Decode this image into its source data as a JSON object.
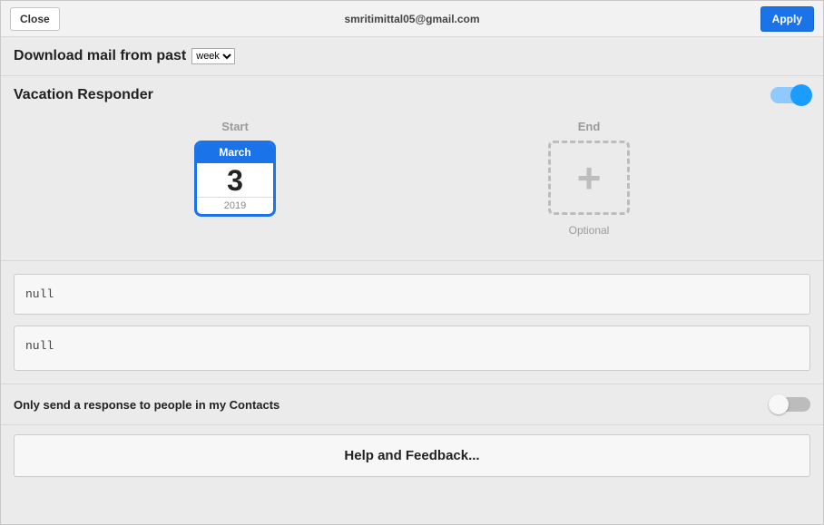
{
  "topbar": {
    "close_label": "Close",
    "email": "smritimittal05@gmail.com",
    "apply_label": "Apply"
  },
  "download_mail": {
    "label": "Download mail from past",
    "selected": "week",
    "options": [
      "week"
    ]
  },
  "vacation": {
    "title": "Vacation Responder",
    "enabled": true,
    "start_label": "Start",
    "start_month": "March",
    "start_day": "3",
    "start_year": "2019",
    "end_label": "End",
    "end_optional": "Optional",
    "subject_value": "null",
    "body_value": "null"
  },
  "contacts_only": {
    "label": "Only send a response to people in my Contacts",
    "enabled": false
  },
  "help": {
    "label": "Help and Feedback..."
  }
}
